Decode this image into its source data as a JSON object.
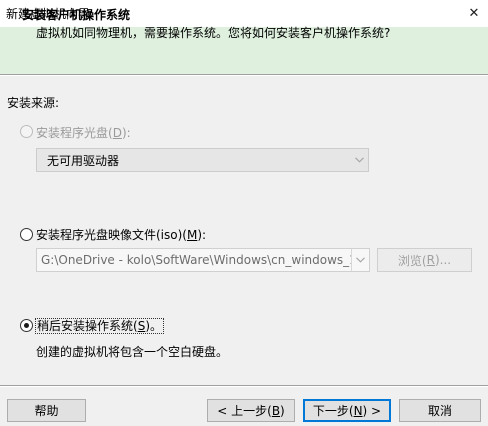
{
  "window": {
    "title": "新建虚拟机向导",
    "close_glyph": "✕"
  },
  "header": {
    "title": "安装客户机操作系统",
    "subtitle": "虚拟机如同物理机，需要操作系统。您将如何安装客户机操作系统?"
  },
  "install_source": {
    "label": "安装来源:",
    "options": [
      {
        "prefix": "安装程序光盘(",
        "mnemonic": "D",
        "suffix": "):",
        "selected": false,
        "enabled": false
      },
      {
        "prefix": "安装程序光盘映像文件(iso)(",
        "mnemonic": "M",
        "suffix": "):",
        "selected": false,
        "enabled": true
      },
      {
        "prefix": "稍后安装操作系统(",
        "mnemonic": "S",
        "suffix": ")。",
        "selected": true,
        "enabled": true
      }
    ],
    "drive_dropdown": {
      "value": "无可用驱动器",
      "icon": "chevron-down-icon"
    },
    "iso_path": {
      "value": "G:\\OneDrive - kolo\\SoftWare\\Windows\\cn_windows_10_",
      "icon": "chevron-down-icon"
    },
    "browse_button": {
      "prefix": "浏览(",
      "mnemonic": "R",
      "suffix": ")..."
    },
    "later_info": "创建的虚拟机将包含一个空白硬盘。"
  },
  "footer": {
    "help": "帮助",
    "back": {
      "prefix": "< 上一步(",
      "mnemonic": "B",
      "suffix": ")"
    },
    "next": {
      "prefix": "下一步(",
      "mnemonic": "N",
      "suffix": ") >"
    },
    "cancel": "取消"
  },
  "colors": {
    "header_bg": "#dff0df",
    "window_bg": "#f0f0f0",
    "accent": "#0078d7"
  }
}
